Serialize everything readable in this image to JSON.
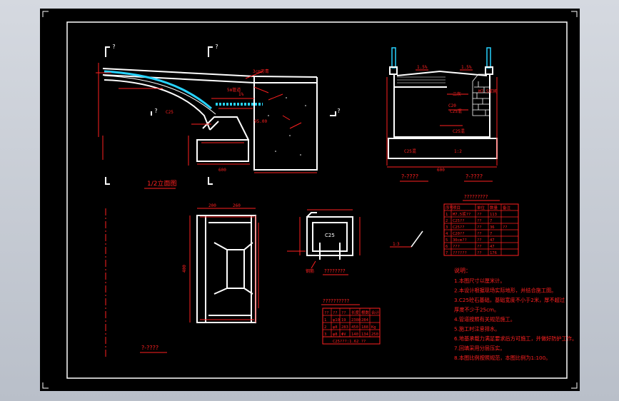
{
  "colors": {
    "background": "#000000",
    "line_white": "#ffffff",
    "line_red": "#ff2020",
    "line_cyan": "#27d3ff",
    "viewer_bg": "#c8cdd6"
  },
  "section_markers": {
    "top_left": "?",
    "top_mid": "?",
    "mid_left": "?",
    "mid_right": "?"
  },
  "elevation": {
    "title": "1/2立面图",
    "labels": {
      "deck_note": "3cm沥青",
      "slope": "1%",
      "pipe_note": "5m管道",
      "c25": "C25",
      "level": "95.00",
      "bottom_dim": "600"
    }
  },
  "cross_section": {
    "title_left": "?-????",
    "title_right": "?-????",
    "labels": {
      "slope_left": "1.5%",
      "slope_right": "1.5%",
      "fill": "二灰",
      "stone": "M7.5浆砌",
      "c20": "C20",
      "c25_upper": "C25混",
      "c25_lower": "C25混",
      "base": "1:2",
      "width": "600"
    }
  },
  "plan": {
    "title": "?-????",
    "dims": {
      "top": "200",
      "top2": "260",
      "left": "400"
    }
  },
  "box_detail": {
    "label": "C25",
    "title": "????????",
    "note_left": "钢筋",
    "note_side": "????"
  },
  "rebar_table": {
    "title": "??????????",
    "headers": [
      "??",
      "??",
      "??",
      "长度",
      "根数",
      "合计"
    ],
    "rows": [
      [
        "1",
        "φ10",
        "19",
        "2380",
        "284",
        ""
      ],
      [
        "2",
        "φ8",
        "283",
        "450",
        "188",
        "Kg"
      ],
      [
        "3",
        "φ8",
        "ΦV",
        "140",
        "134",
        "250"
      ]
    ],
    "footer": "C25???:1.62 ??"
  },
  "qty_table": {
    "title": "?????????",
    "headers": [
      "序号",
      "项目",
      "单位",
      "数量",
      "备注"
    ],
    "rows": [
      [
        "1",
        "M7.5浆??",
        "??",
        "113",
        ""
      ],
      [
        "2",
        "C25??",
        "??",
        "7",
        ""
      ],
      [
        "3",
        "C25??",
        "??",
        "36",
        "??"
      ],
      [
        "4",
        "C20??",
        "??",
        "7",
        ""
      ],
      [
        "5",
        "30cm??",
        "??",
        "47",
        ""
      ],
      [
        "6",
        "???",
        "??",
        "47",
        ""
      ],
      [
        "7",
        "??????",
        "??",
        "176",
        ""
      ]
    ]
  },
  "notes": {
    "heading": "说明：",
    "items": [
      "1.本图尺寸以厘米计。",
      "2.本设计根据现场实际地形，并结合施工图。",
      "3.C25砼石基础，基础宽度不小于2米，厚不超过",
      "  厚度不少于25cm。",
      "4.管道按照有关规范施工。",
      "5.施工时注意排水。",
      "6.地基承载力满足要求后方可施工，并做好防护工作。",
      "7.回填采用分层压实。",
      "8.本图比例按照规范，本图比例为1:100。"
    ]
  },
  "slope_mark": "1:3"
}
